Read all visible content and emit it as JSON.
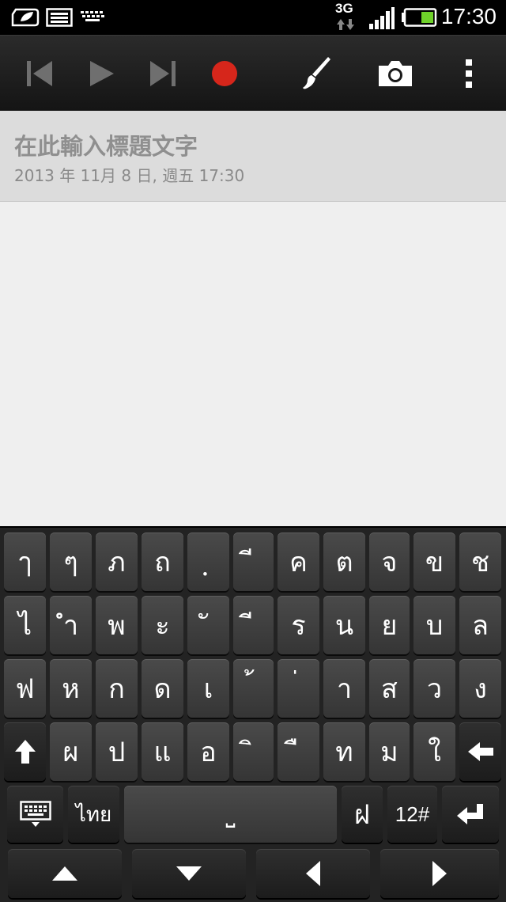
{
  "status_bar": {
    "time": "17:30",
    "network": "3G",
    "icons": [
      "power-saver-icon",
      "image-notification-icon",
      "keyboard-notification-icon",
      "data-3g-icon",
      "signal-icon",
      "battery-icon"
    ]
  },
  "toolbar": {
    "buttons": [
      "skip-previous-icon",
      "play-icon",
      "skip-next-icon",
      "record-icon",
      "brush-icon",
      "camera-icon",
      "overflow-menu-icon"
    ],
    "record_color": "#d6261b"
  },
  "note": {
    "title_placeholder": "在此輸入標題文字",
    "date": "2013 年 11月 8 日, 週五 17:30"
  },
  "keyboard": {
    "row1": [
      "ๅ",
      "ๆ",
      "ภ",
      "ถ",
      "ฺ",
      "ี",
      "ค",
      "ต",
      "จ",
      "ข",
      "ช"
    ],
    "row2": [
      "ไ",
      "ำ",
      "พ",
      "ะ",
      "ั",
      "ี",
      "ร",
      "น",
      "ย",
      "บ",
      "ล"
    ],
    "row3": [
      "ฟ",
      "ห",
      "ก",
      "ด",
      "เ",
      "้",
      "่",
      "า",
      "ส",
      "ว",
      "ง"
    ],
    "row4": [
      "ผ",
      "ป",
      "แ",
      "อ",
      "ิ",
      "ื",
      "ท",
      "ม",
      "ใ"
    ],
    "lang_label": "ไทย",
    "space_label": "⎵",
    "extra_key": "ฝ",
    "symbols_label": "12#"
  }
}
